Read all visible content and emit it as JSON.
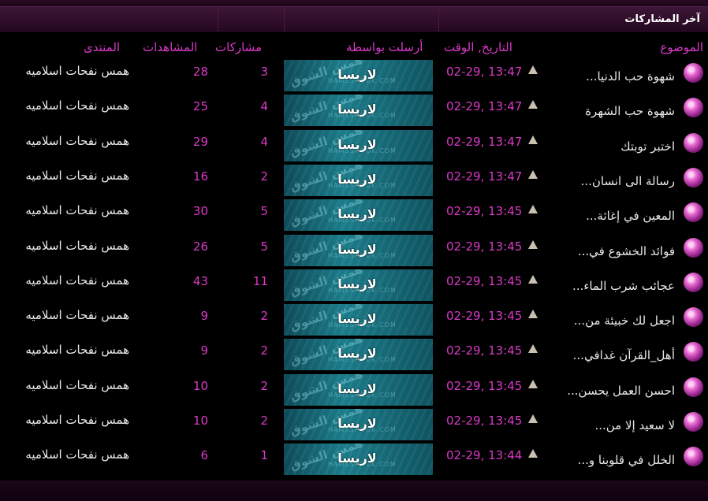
{
  "header": {
    "title": "آخر المشاركات"
  },
  "columns": {
    "topic": "الموضوع",
    "datetime": "التاريخ, الوقت",
    "poster": "أرسلت بواسطة",
    "posts": "مشاركات",
    "views": "المشاهدات",
    "forum": "المنتدى"
  },
  "banner": {
    "watermark_text": "همس الشوق",
    "watermark_url": "HAMSSHOOK.COM"
  },
  "colors": {
    "accent": "#d93ac7",
    "text": "#e8e8e8",
    "background": "#000000",
    "header": "#3d1638"
  },
  "rows": [
    {
      "topic": "شهوة حب الدنيا...",
      "datetime": "02-29, 13:47",
      "poster": "لاريسا",
      "posts": "3",
      "views": "28",
      "forum": "همس نفحات اسلاميه"
    },
    {
      "topic": "شهوة حب الشهرة",
      "datetime": "02-29, 13:47",
      "poster": "لاريسا",
      "posts": "4",
      "views": "25",
      "forum": "همس نفحات اسلاميه"
    },
    {
      "topic": "اختبر توبتك",
      "datetime": "02-29, 13:47",
      "poster": "لاريسا",
      "posts": "4",
      "views": "29",
      "forum": "همس نفحات اسلاميه"
    },
    {
      "topic": "رسالة الى انسان...",
      "datetime": "02-29, 13:47",
      "poster": "لاريسا",
      "posts": "2",
      "views": "16",
      "forum": "همس نفحات اسلاميه"
    },
    {
      "topic": "المعين في إغاثة...",
      "datetime": "02-29, 13:45",
      "poster": "لاريسا",
      "posts": "5",
      "views": "30",
      "forum": "همس نفحات اسلاميه"
    },
    {
      "topic": "فوائد الخشوع في...",
      "datetime": "02-29, 13:45",
      "poster": "لاريسا",
      "posts": "5",
      "views": "26",
      "forum": "همس نفحات اسلاميه"
    },
    {
      "topic": "عجائب شرب الماء...",
      "datetime": "02-29, 13:45",
      "poster": "لاريسا",
      "posts": "11",
      "views": "43",
      "forum": "همس نفحات اسلاميه"
    },
    {
      "topic": "اجعل لك خبيئة من...",
      "datetime": "02-29, 13:45",
      "poster": "لاريسا",
      "posts": "2",
      "views": "9",
      "forum": "همس نفحات اسلاميه"
    },
    {
      "topic": "أهل_القرآن غدافي...",
      "datetime": "02-29, 13:45",
      "poster": "لاريسا",
      "posts": "2",
      "views": "9",
      "forum": "همس نفحات اسلاميه"
    },
    {
      "topic": "احسن العمل يحسن...",
      "datetime": "02-29, 13:45",
      "poster": "لاريسا",
      "posts": "2",
      "views": "10",
      "forum": "همس نفحات اسلاميه"
    },
    {
      "topic": "لا سعيد إلا من...",
      "datetime": "02-29, 13:45",
      "poster": "لاريسا",
      "posts": "2",
      "views": "10",
      "forum": "همس نفحات اسلاميه"
    },
    {
      "topic": "الخلل في قلوبنا و...",
      "datetime": "02-29, 13:44",
      "poster": "لاريسا",
      "posts": "1",
      "views": "6",
      "forum": "همس نفحات اسلاميه"
    }
  ]
}
